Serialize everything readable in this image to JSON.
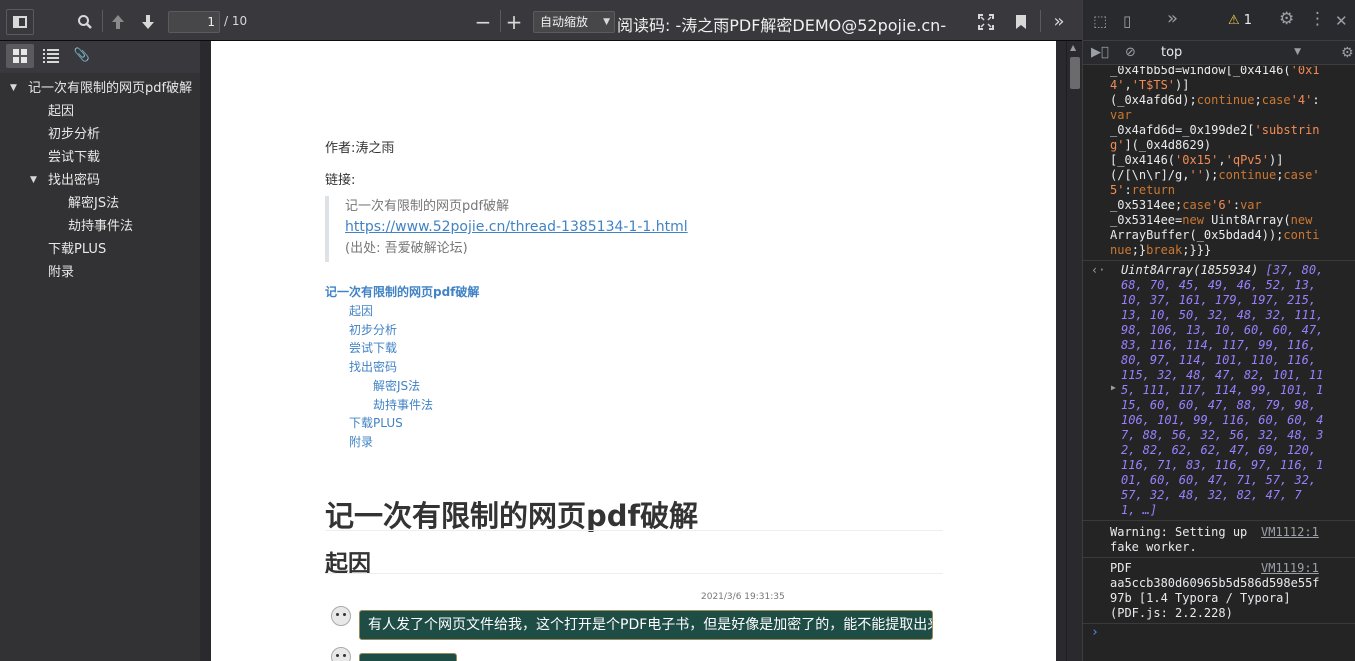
{
  "toolbar": {
    "page_value": "1",
    "page_count": "/ 10",
    "zoom": "自动缩放",
    "doc_title": "阅读码: -涛之雨PDF解密DEMO@52pojie.cn-"
  },
  "outline": [
    {
      "label": "记一次有限制的网页pdf破解",
      "expanded": true
    },
    {
      "label": "起因"
    },
    {
      "label": "初步分析"
    },
    {
      "label": "尝试下载"
    },
    {
      "label": "找出密码",
      "expanded": true
    },
    {
      "label": "解密JS法"
    },
    {
      "label": "劫持事件法"
    },
    {
      "label": "下载PLUS"
    },
    {
      "label": "附录"
    }
  ],
  "page": {
    "author": "作者:涛之雨",
    "link_label": "链接:",
    "quote_title": "记一次有限制的网页pdf破解",
    "quote_url": "https://www.52pojie.cn/thread-1385134-1-1.html",
    "quote_source": "(出处: 吾爱破解论坛)",
    "toc": [
      "记一次有限制的网页pdf破解",
      "起因",
      "初步分析",
      "尝试下载",
      "找出密码",
      "解密JS法",
      "劫持事件法",
      "下载PLUS",
      "附录"
    ],
    "h1": "记一次有限制的网页pdf破解",
    "h2": "起因",
    "timestamp": "2021/3/6 19:31:35",
    "chat_message": "有人发了个网页文件给我，这个打开是个PDF电子书，但是好像是加密了的，能不能提取出来"
  },
  "devtools": {
    "warning_count": "1",
    "context": "top",
    "warning_text_1": "Warning: Setting up",
    "warning_text_2": "fake worker.",
    "warning_src": "VM1112:1",
    "pdf_label": "PDF",
    "pdf_src": "VM1119:1",
    "pdf_text_1": "aa5ccb380d60965b5d586d598e55f",
    "pdf_text_2": "97b [1.4 Typora / Typora]",
    "pdf_text_3": "(PDF.js: 2.2.228)",
    "array_head": "Uint8Array(1855934)",
    "array_lines": [
      "[37, 80,",
      "68, 70, 45, 49, 46, 52, 13,",
      "10, 37, 161, 179, 197, 215,",
      "13, 10, 50, 32, 48, 32, 111,",
      "98, 106, 13, 10, 60, 60, 47,",
      "83, 116, 114, 117, 99, 116,",
      "80, 97, 114, 101, 110, 116,",
      "115, 32, 48, 47, 82, 101, 11",
      "5, 111, 117, 114, 99, 101, 1",
      "15, 60, 60, 47, 88, 79, 98,",
      "106, 101, 99, 116, 60, 60, 4",
      "7, 88, 56, 32, 56, 32, 48, 3",
      "2, 82, 62, 62, 47, 69, 120,",
      "116, 71, 83, 116, 97, 116, 1",
      "01, 60, 60, 47, 71, 57, 32,",
      "57, 32, 48, 32, 82, 47, 7",
      "1, …]"
    ],
    "code": {
      "l1a": "_0x4fbb5d",
      "l1b": "=window[_0x4146(",
      "l1c": "'0x1",
      "l2a": "4'",
      "l2b": ",",
      "l2c": "'T$TS'",
      "l2d": ")]",
      "l3a": "(_0x4afd6d);",
      "l3b": "continue",
      "l3c": ";",
      "l3d": "case",
      "l3e": "'4'",
      "l3f": ":",
      "l4": "var",
      "l5a": "_0x4afd6d=_0x199de2[",
      "l5b": "'substrin",
      "l6a": "g'",
      "l6b": "](_0x4d8629)",
      "l7a": "[_0x4146(",
      "l7b": "'0x15'",
      "l7c": ",",
      "l7d": "'qPv5'",
      "l7e": ")]",
      "l8a": "(/[\\n\\r]/g,",
      "l8b": "''",
      "l8c": ");",
      "l8d": "continue",
      "l8e": ";",
      "l8f": "case",
      "l8g": "'",
      "l9a": "5'",
      "l9b": ":",
      "l9c": "return",
      "l10a": "_0x5314ee;",
      "l10b": "case",
      "l10c": "'6'",
      "l10d": ":",
      "l10e": "var",
      "l11a": "_0x5314ee=",
      "l11b": "new",
      "l11c": " Uint8Array(",
      "l11d": "new",
      "l12a": "ArrayBuffer(_0x5bdad4));",
      "l12b": "conti",
      "l13a": "nue",
      "l13b": ";}",
      "l13c": "break",
      "l13d": ";}}}"
    }
  }
}
